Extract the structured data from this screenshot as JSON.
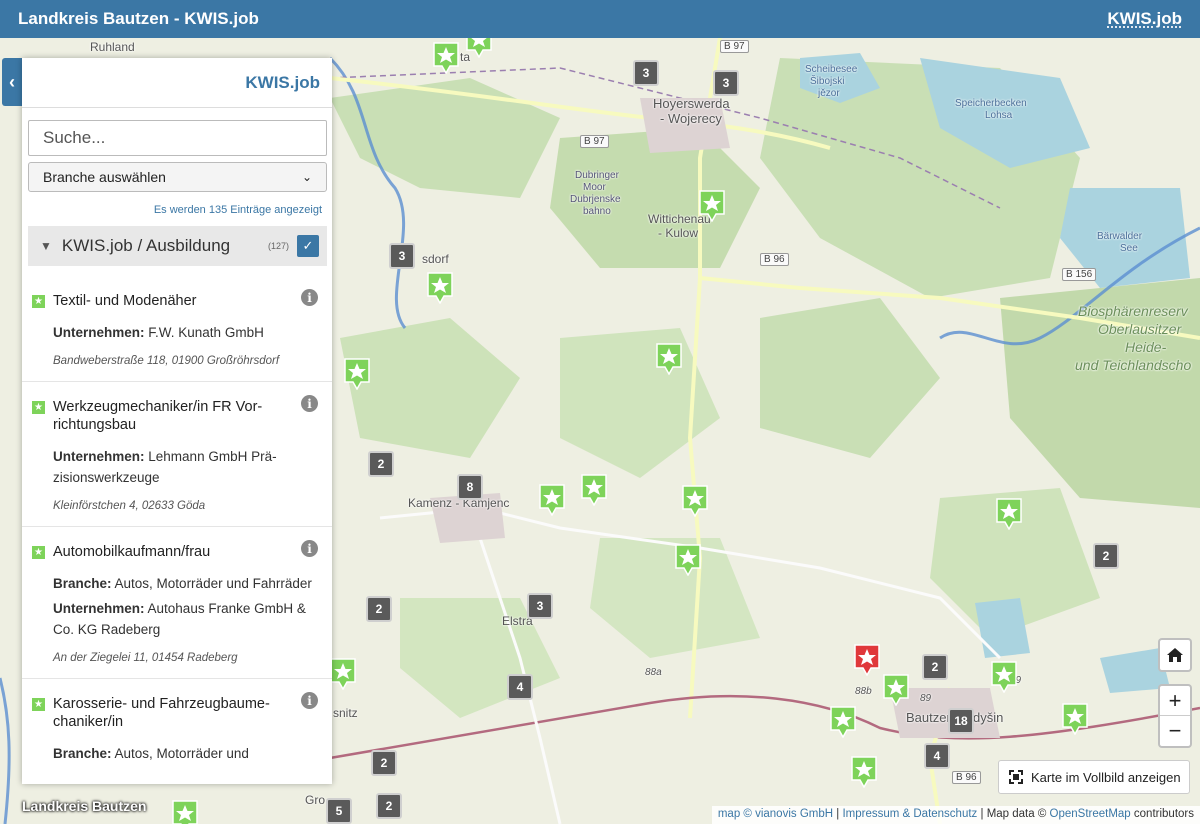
{
  "header": {
    "title": "Landkreis Bautzen - KWIS.job",
    "brand": "KWIS.job"
  },
  "panel": {
    "title": "KWIS.job",
    "search_placeholder": "Suche...",
    "branch_select": "Branche auswählen",
    "entry_count": "Es werden 135 Einträge angezeigt",
    "category": {
      "label": "KWIS.job / Ausbildung",
      "count": "(127)"
    },
    "entries": [
      {
        "title": "Textil- und Modenäher",
        "company_label": "Unternehmen:",
        "company": "F.W. Kunath GmbH",
        "address": "Bandweberstraße 118, 01900 Großröhrsdorf"
      },
      {
        "title": "Werkzeugmechaniker/in FR Vor-richtungsbau",
        "company_label": "Unternehmen:",
        "company": "Lehmann GmbH Prä-zisionswerkzeuge",
        "address": "Kleinförstchen 4, 02633 Göda"
      },
      {
        "title": "Automobilkaufmann/frau",
        "branch_label": "Branche:",
        "branch": "Autos, Motorräder und Fahrräder",
        "company_label": "Unternehmen:",
        "company": "Autohaus Franke GmbH & Co. KG Radeberg",
        "address": "An der Ziegelei 11, 01454 Radeberg"
      },
      {
        "title": "Karosserie- und Fahrzeugbaume-chaniker/in",
        "branch_label": "Branche:",
        "branch": "Autos, Motorräder und"
      }
    ]
  },
  "map": {
    "places": [
      "Ruhland",
      "Hoyerswerda",
      "- Wojerecy",
      "Scheibesee",
      "Šibojski",
      "jězor",
      "Speicherbecken",
      "Lohsa",
      "Dubringer",
      "Moor",
      "Dubrjenske",
      "bahno",
      "Wittichenau",
      "- Kulow",
      "Bärwalder",
      "See",
      "Biosphärenreserv",
      "Oberlausitzer",
      "Heide-",
      "und Teichlandscho",
      "Kamenz - Kamjenc",
      "Elstra",
      "Bautzen",
      "dyšin",
      "snitz",
      "Gro",
      "sdorf",
      "ta"
    ],
    "roads": [
      "B 97",
      "B 97",
      "B 96",
      "B 156",
      "B 96",
      "88a",
      "88b",
      "89",
      "89"
    ],
    "clusters": [
      "3",
      "3",
      "3",
      "2",
      "8",
      "3",
      "2",
      "2",
      "4",
      "2",
      "18",
      "4",
      "2",
      "5",
      "2"
    ],
    "marker_colors": {
      "job": "#7ed35a",
      "selected": "#e0383b"
    }
  },
  "controls": {
    "home_icon": "home-icon",
    "zoom_in": "+",
    "zoom_out": "−",
    "fullscreen_label": "Karte im Vollbild anzeigen"
  },
  "attribution": {
    "map_link": "map © vianovis GmbH",
    "imprint_link": "Impressum & Datenschutz",
    "data_text": "Map data ©",
    "osm_link": "OpenStreetMap",
    "suffix": "contributors"
  },
  "logo_text": "Landkreis Bautzen"
}
